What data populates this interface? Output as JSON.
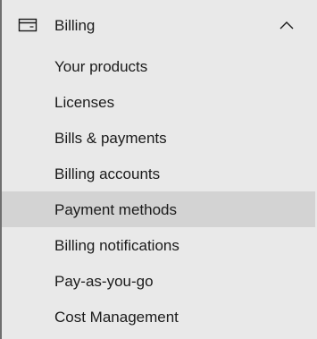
{
  "billing": {
    "label": "Billing",
    "icon": "credit-card-icon",
    "expanded": true,
    "chevron_icon": "chevron-up-icon",
    "items": [
      {
        "label": "Your products"
      },
      {
        "label": "Licenses"
      },
      {
        "label": "Bills & payments"
      },
      {
        "label": "Billing accounts"
      },
      {
        "label": "Payment methods",
        "selected": true
      },
      {
        "label": "Billing notifications"
      },
      {
        "label": "Pay-as-you-go"
      },
      {
        "label": "Cost Management"
      }
    ]
  },
  "colors": {
    "background": "#e9e9e9",
    "selected_background": "#d3d3d3",
    "text": "#1b1b1b",
    "left_edge": "#6f6f6f"
  }
}
